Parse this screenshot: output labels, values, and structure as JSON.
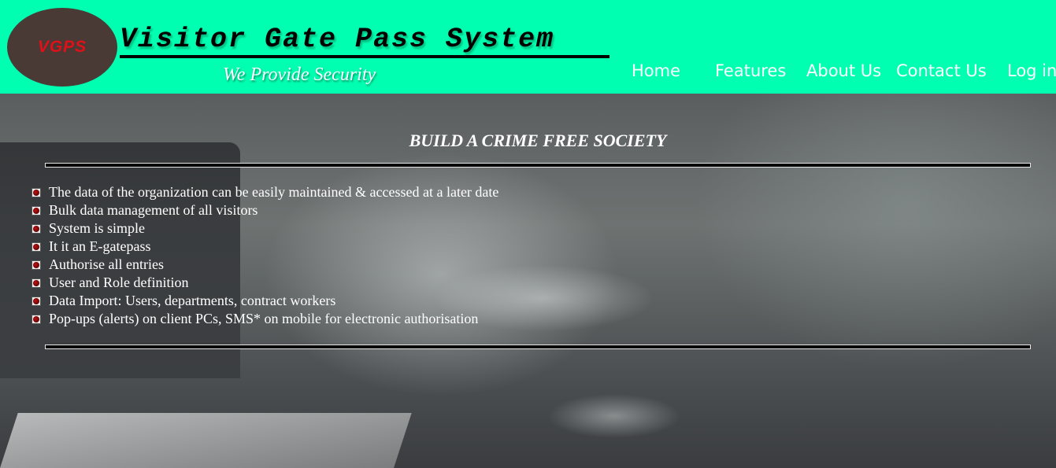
{
  "header": {
    "logo_text": "VGPS",
    "title": "Visitor Gate Pass System",
    "tagline": "We Provide Security",
    "bg_color": "#00ffb0"
  },
  "nav": {
    "items": [
      {
        "label": "Home"
      },
      {
        "label": "Features"
      },
      {
        "label": "About Us"
      },
      {
        "label": "Contact Us"
      },
      {
        "label": "Log in"
      }
    ]
  },
  "main": {
    "heading": "BUILD A CRIME FREE SOCIETY",
    "features": [
      "The data of the organization can be easily maintained & accessed at a later date",
      "Bulk data management of all visitors",
      "System is simple",
      "It it an E-gatepass",
      "Authorise all entries",
      "User and Role definition",
      "Data Import: Users, departments, contract workers",
      "Pop-ups (alerts) on client PCs, SMS* on mobile for electronic authorisation"
    ],
    "bullet_icon": "red-dot-bullet-icon"
  }
}
